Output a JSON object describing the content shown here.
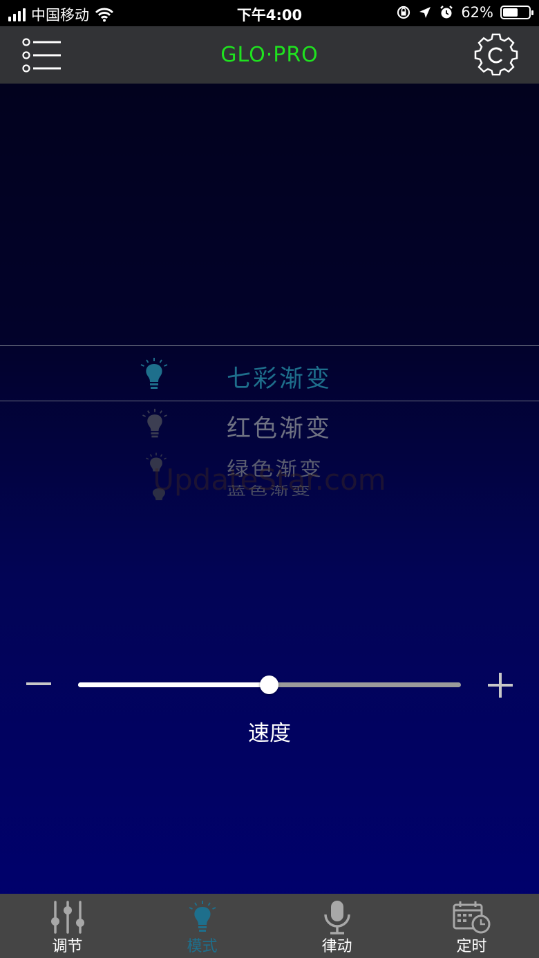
{
  "status_bar": {
    "carrier": "中国移动",
    "time": "下午4:00",
    "battery_percent": "62%",
    "battery_level": 0.62
  },
  "header": {
    "title": "GLO·PRO",
    "menu_icon": "list-menu-icon",
    "settings_icon": "gear-icon"
  },
  "mode_picker": {
    "items": [
      {
        "label": "七彩渐变",
        "selected": true
      },
      {
        "label": "红色渐变",
        "selected": false
      },
      {
        "label": "绿色渐变",
        "selected": false
      },
      {
        "label": "蓝色渐变",
        "selected": false
      }
    ],
    "selected_color": "#1e6f8c"
  },
  "watermark": "UpdateStar.com",
  "speed": {
    "label": "速度",
    "value": 0.5,
    "minus_icon": "minus-icon",
    "plus_icon": "plus-icon"
  },
  "tab_bar": {
    "tabs": [
      {
        "label": "调节",
        "icon": "sliders-icon",
        "active": false
      },
      {
        "label": "模式",
        "icon": "bulb-icon",
        "active": true
      },
      {
        "label": "律动",
        "icon": "microphone-icon",
        "active": false
      },
      {
        "label": "定时",
        "icon": "calendar-clock-icon",
        "active": false
      }
    ],
    "active_color": "#1e6f8c",
    "inactive_color": "#ffffff"
  }
}
